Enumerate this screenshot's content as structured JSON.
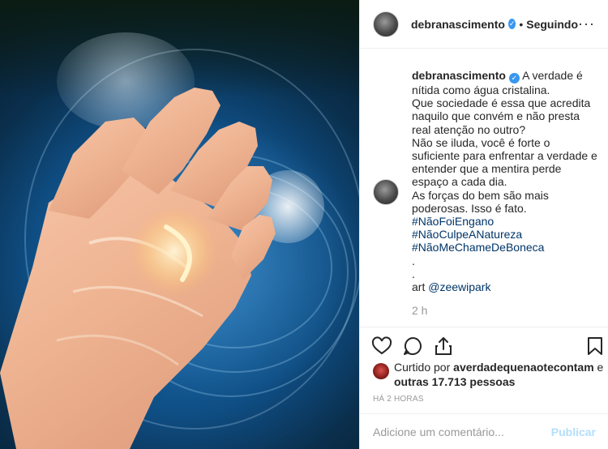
{
  "post": {
    "image_alt": "",
    "author": "debranascimento",
    "follow_status": "Seguindo",
    "more_icon": "more-horizontal-icon",
    "verified_icon": "verified-badge-icon",
    "caption": {
      "username": "debranascimento",
      "lines": [
        "A verdade é nítida como água cristalina.",
        "Que sociedade é essa que acredita naquilo que convém e não presta real atenção no outro?",
        "Não se iluda, você é forte o suficiente para enfrentar a verdade e entender que a mentira perde espaço a cada dia.",
        "As forças do bem são mais poderosas. Isso é fato."
      ],
      "hashtags": [
        "#NãoFoiEngano",
        "#NãoCulpeANatureza",
        "#NãoMeChameDeBoneca"
      ],
      "dots": [
        ".",
        "."
      ],
      "art_prefix": "art",
      "art_mention": "@zeewipark",
      "time": "2 h"
    },
    "actions": {
      "like_icon": "heart-icon",
      "comment_icon": "comment-icon",
      "share_icon": "share-icon",
      "save_icon": "bookmark-icon"
    },
    "likes": {
      "prefix": "Curtido por",
      "user": "averdadequenaotecontam",
      "middle": "e",
      "others": "outras 17.713 pessoas"
    },
    "time_ago": "HÁ 2 HORAS",
    "comment_box": {
      "placeholder": "Adicione um comentário...",
      "publish": "Publicar"
    }
  },
  "colors": {
    "link": "#003569",
    "verified": "#3897f0",
    "muted": "#999999",
    "publish_disabled": "#b2dffc",
    "border": "#efefef"
  }
}
